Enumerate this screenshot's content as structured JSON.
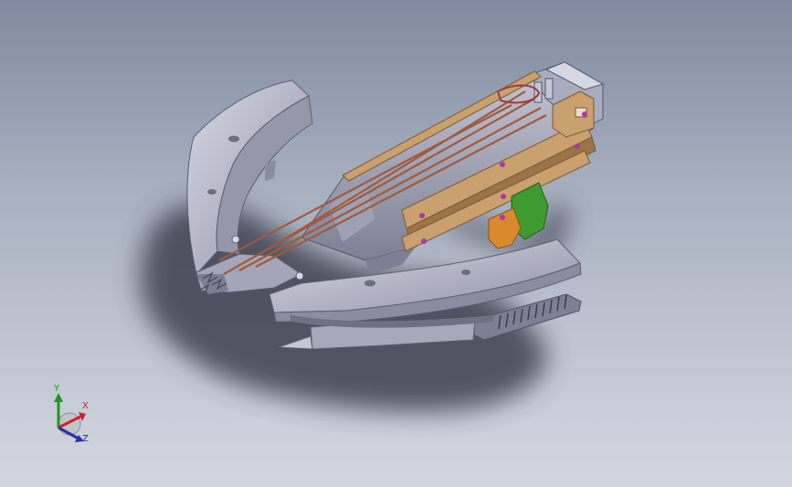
{
  "viewport": {
    "background_top": "#7f8aa0",
    "background_bottom": "#d3d7df"
  },
  "model": {
    "name_icon": "crossbow-3d-model-icon",
    "colors": {
      "body": "#b0b2c2",
      "body_dark": "#7d8095",
      "body_light": "#d6d8e4",
      "rail": "#c9a06e",
      "rail_dark": "#9a7446",
      "string": "#a05a3a",
      "grip_green": "#3f9a30",
      "trigger_orange": "#d88a2c",
      "bolt": "#a83aa0",
      "shadow": "#3e4150"
    }
  },
  "triad": {
    "x_label": "X",
    "y_label": "Y",
    "z_label": "Z",
    "x_color": "#c8242a",
    "y_color": "#1a9a1a",
    "z_color": "#2233aa"
  }
}
